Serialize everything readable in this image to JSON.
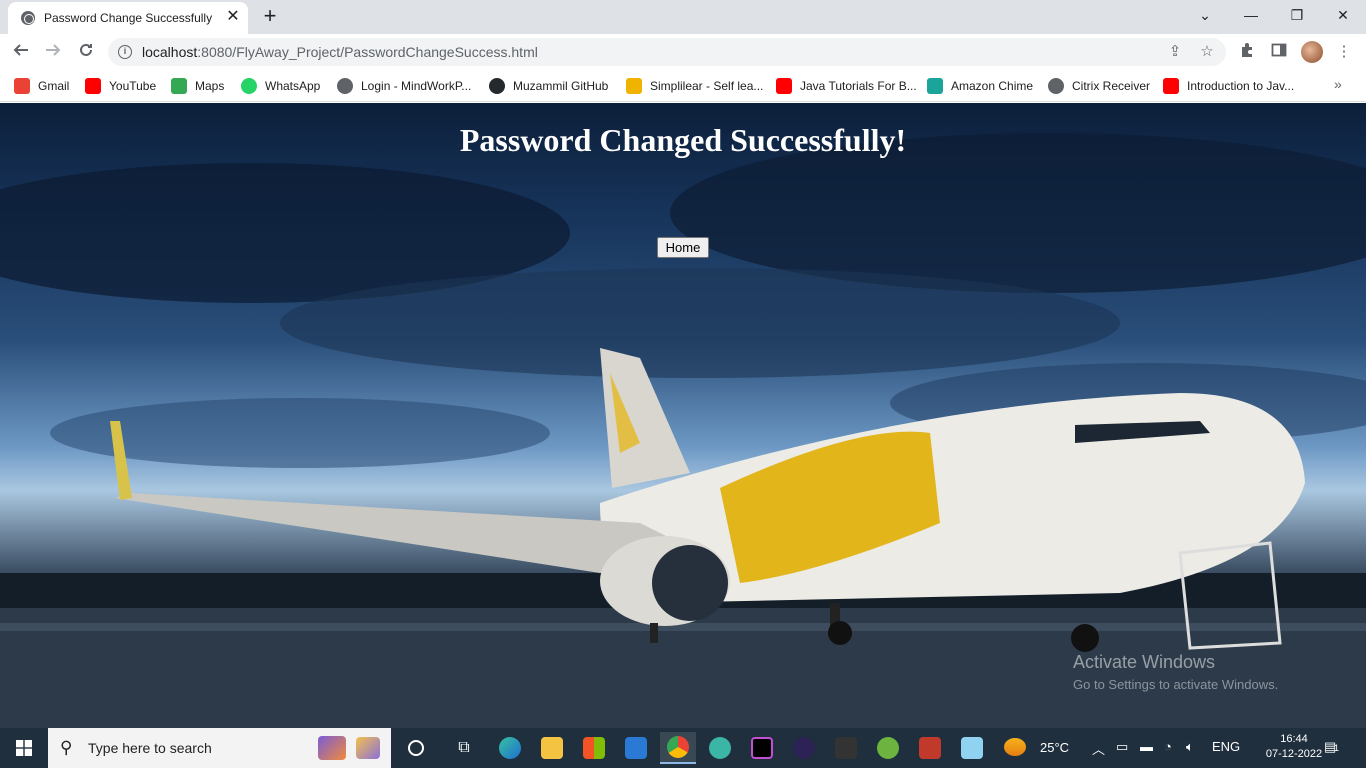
{
  "browser": {
    "tab_title": "Password Change Successfully",
    "tab_close": "✕",
    "new_tab": "+",
    "window_controls": {
      "dropdown": "⌄",
      "minimize": "—",
      "restore": "❐",
      "close": "✕"
    },
    "url_host": "localhost",
    "url_rest": ":8080/FlyAway_Project/PasswordChangeSuccess.html",
    "bookmarks": [
      {
        "label": "Gmail",
        "icon": "gmail-icon",
        "color": "#ea4335"
      },
      {
        "label": "YouTube",
        "icon": "youtube-icon",
        "color": "#ff0000"
      },
      {
        "label": "Maps",
        "icon": "maps-icon",
        "color": "#34a853"
      },
      {
        "label": "WhatsApp",
        "icon": "whatsapp-icon",
        "color": "#25d366"
      },
      {
        "label": "Login - MindWorkP...",
        "icon": "globe-icon",
        "color": "#5f6368"
      },
      {
        "label": "Muzammil GitHub",
        "icon": "github-icon",
        "color": "#24292e"
      },
      {
        "label": "Simplilear - Self lea...",
        "icon": "simplilearn-icon",
        "color": "#f0b400"
      },
      {
        "label": "Java Tutorials For B...",
        "icon": "youtube-icon",
        "color": "#ff0000"
      },
      {
        "label": "Amazon Chime",
        "icon": "chime-icon",
        "color": "#1ba59a"
      },
      {
        "label": "Citrix Receiver",
        "icon": "citrix-icon",
        "color": "#5f6368"
      },
      {
        "label": "Introduction to Jav...",
        "icon": "youtube-icon",
        "color": "#ff0000"
      }
    ],
    "bookmarks_more": "»"
  },
  "page": {
    "title": "Password Changed Successfully!",
    "home_button": "Home",
    "watermark_title": "Activate Windows",
    "watermark_sub": "Go to Settings to activate Windows."
  },
  "taskbar": {
    "search_placeholder": "Type here to search",
    "weather": "25°C",
    "language": "ENG",
    "time": "16:44",
    "date": "07-12-2022",
    "notification_count": "1"
  }
}
